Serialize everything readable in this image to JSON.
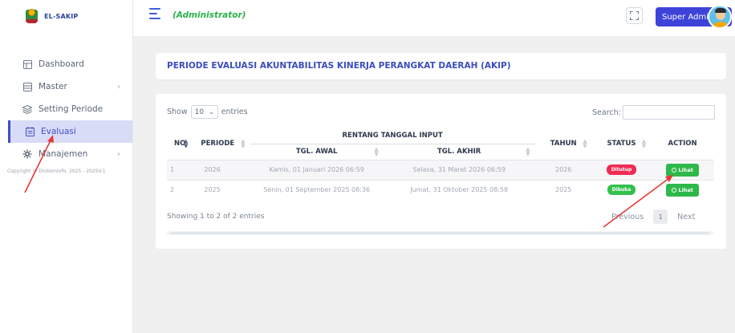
{
  "brand": {
    "name": "EL-SAKIP"
  },
  "sidebar": {
    "items": [
      {
        "label": "Dashboard",
        "icon": "dashboard-icon",
        "has_chevron": false,
        "active": false
      },
      {
        "label": "Master",
        "icon": "master-icon",
        "has_chevron": true,
        "active": false
      },
      {
        "label": "Setting Periode",
        "icon": "setting-periode-icon",
        "has_chevron": false,
        "active": false
      },
      {
        "label": "Evaluasi",
        "icon": "evaluasi-icon",
        "has_chevron": false,
        "active": true
      },
      {
        "label": "Manajemen",
        "icon": "gear-icon",
        "has_chevron": true,
        "active": false
      }
    ],
    "copyright": "Copyright © Dinkominfo. 2025 - 2025V.1"
  },
  "topbar": {
    "role": "(Administrator)",
    "user_label": "Super Admin"
  },
  "page": {
    "title": "PERIODE EVALUASI AKUNTABILITAS KINERJA PERANGKAT DAERAH (AKIP)"
  },
  "table": {
    "show_label": "Show",
    "entries_value": "10",
    "entries_label": "entries",
    "search_label": "Search:",
    "search_value": "",
    "headers": {
      "no": "NO",
      "periode": "PERIODE",
      "rentang": "RENTANG TANGGAL INPUT",
      "tgl_awal": "TGL. AWAL",
      "tgl_akhir": "TGL. AKHIR",
      "tahun": "TAHUN",
      "status": "STATUS",
      "action": "ACTION"
    },
    "rows": [
      {
        "no": "1",
        "periode": "2026",
        "tgl_awal": "Kamis, 01 Januari 2026 06:59",
        "tgl_akhir": "Selasa, 31 Maret 2026 06:59",
        "tahun": "2026",
        "status": "Ditutup",
        "status_color": "#ef2b53",
        "action": "Lihat"
      },
      {
        "no": "2",
        "periode": "2025",
        "tgl_awal": "Senin, 01 September 2025 08:36",
        "tgl_akhir": "Jumat, 31 Oktober 2025 08:58",
        "tahun": "2025",
        "status": "Dibuka",
        "status_color": "#33c04d",
        "action": "Lihat"
      }
    ],
    "info": "Showing 1 to 2 of 2 entries",
    "pager": {
      "prev": "Previous",
      "page": "1",
      "next": "Next"
    }
  },
  "colors": {
    "accent": "#3d43d8",
    "role": "#2bb24c",
    "annotation": "#e53935"
  }
}
